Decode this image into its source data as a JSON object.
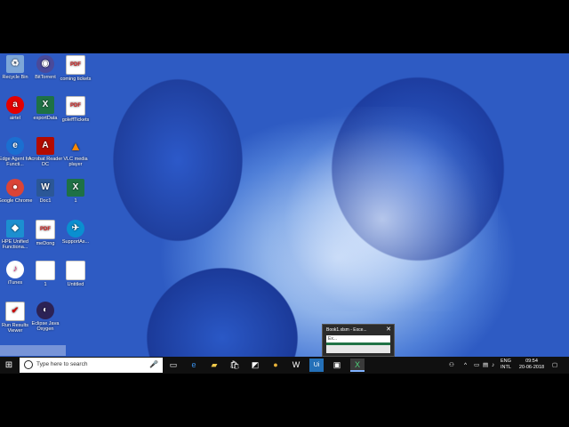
{
  "desktop_icons": [
    {
      "label": "Recycle Bin",
      "glyph": "♻",
      "icon": "recycle-bin-icon"
    },
    {
      "label": "BitTorrent",
      "glyph": "◉",
      "icon": "bittorrent-icon"
    },
    {
      "label": "coming tickets",
      "glyph": "PDF",
      "icon": "pdf-icon"
    },
    {
      "label": "airtel",
      "glyph": "a",
      "icon": "airtel-icon"
    },
    {
      "label": "exportData",
      "glyph": "X",
      "icon": "excel-icon"
    },
    {
      "label": "goleffTickets",
      "glyph": "PDF",
      "icon": "pdf-icon"
    },
    {
      "label": "Edge Agent for Functi...",
      "glyph": "e",
      "icon": "edge-agent-icon"
    },
    {
      "label": "Acrobat Reader DC",
      "glyph": "A",
      "icon": "acrobat-icon"
    },
    {
      "label": "VLC media player",
      "glyph": "▲",
      "icon": "vlc-icon"
    },
    {
      "label": "Google Chrome",
      "glyph": "●",
      "icon": "chrome-icon"
    },
    {
      "label": "Doc1",
      "glyph": "W",
      "icon": "word-icon"
    },
    {
      "label": "1",
      "glyph": "X",
      "icon": "excel-icon"
    },
    {
      "label": "HPE Unified Functiona...",
      "glyph": "◆",
      "icon": "hpe-icon"
    },
    {
      "label": "meDong",
      "glyph": "PDF",
      "icon": "pdf-icon"
    },
    {
      "label": "SupportAs...",
      "glyph": "✈",
      "icon": "support-assistant-icon"
    },
    {
      "label": "iTunes",
      "glyph": "♪",
      "icon": "itunes-icon"
    },
    {
      "label": "1",
      "glyph": "",
      "icon": "blank-file-icon"
    },
    {
      "label": "Untitled",
      "glyph": "",
      "icon": "blank-file-icon"
    },
    {
      "label": "Run Results Viewer",
      "glyph": "✔",
      "icon": "run-results-icon"
    },
    {
      "label": "Eclipse Java Oxygen",
      "glyph": "◐",
      "icon": "eclipse-icon"
    }
  ],
  "thumbnail": {
    "title": "Book1.xlsm - Exce...",
    "close": "✕",
    "window_label": "Ex..."
  },
  "taskbar": {
    "start_glyph": "⊞",
    "search_placeholder": "Type here to search",
    "mic_glyph": "🎤",
    "apps": [
      {
        "name": "task-view-icon",
        "glyph": "▭"
      },
      {
        "name": "edge-icon",
        "glyph": "e"
      },
      {
        "name": "file-explorer-icon",
        "glyph": "▰"
      },
      {
        "name": "store-icon",
        "glyph": "🛍"
      },
      {
        "name": "app-icon",
        "glyph": "◩"
      },
      {
        "name": "chrome-icon",
        "glyph": "●"
      },
      {
        "name": "word-icon",
        "glyph": "W"
      },
      {
        "name": "uipath-icon",
        "glyph": "Ui"
      },
      {
        "name": "app-icon",
        "glyph": "▣"
      },
      {
        "name": "excel-icon",
        "glyph": "X"
      }
    ],
    "tray": {
      "people": "⚇",
      "chevron": "^",
      "battery": "▭",
      "network": "▤",
      "volume": "♪",
      "lang_top": "ENG",
      "lang_bottom": "INTL",
      "time": "09:54",
      "date": "20-06-2018",
      "notification": "▢"
    }
  }
}
